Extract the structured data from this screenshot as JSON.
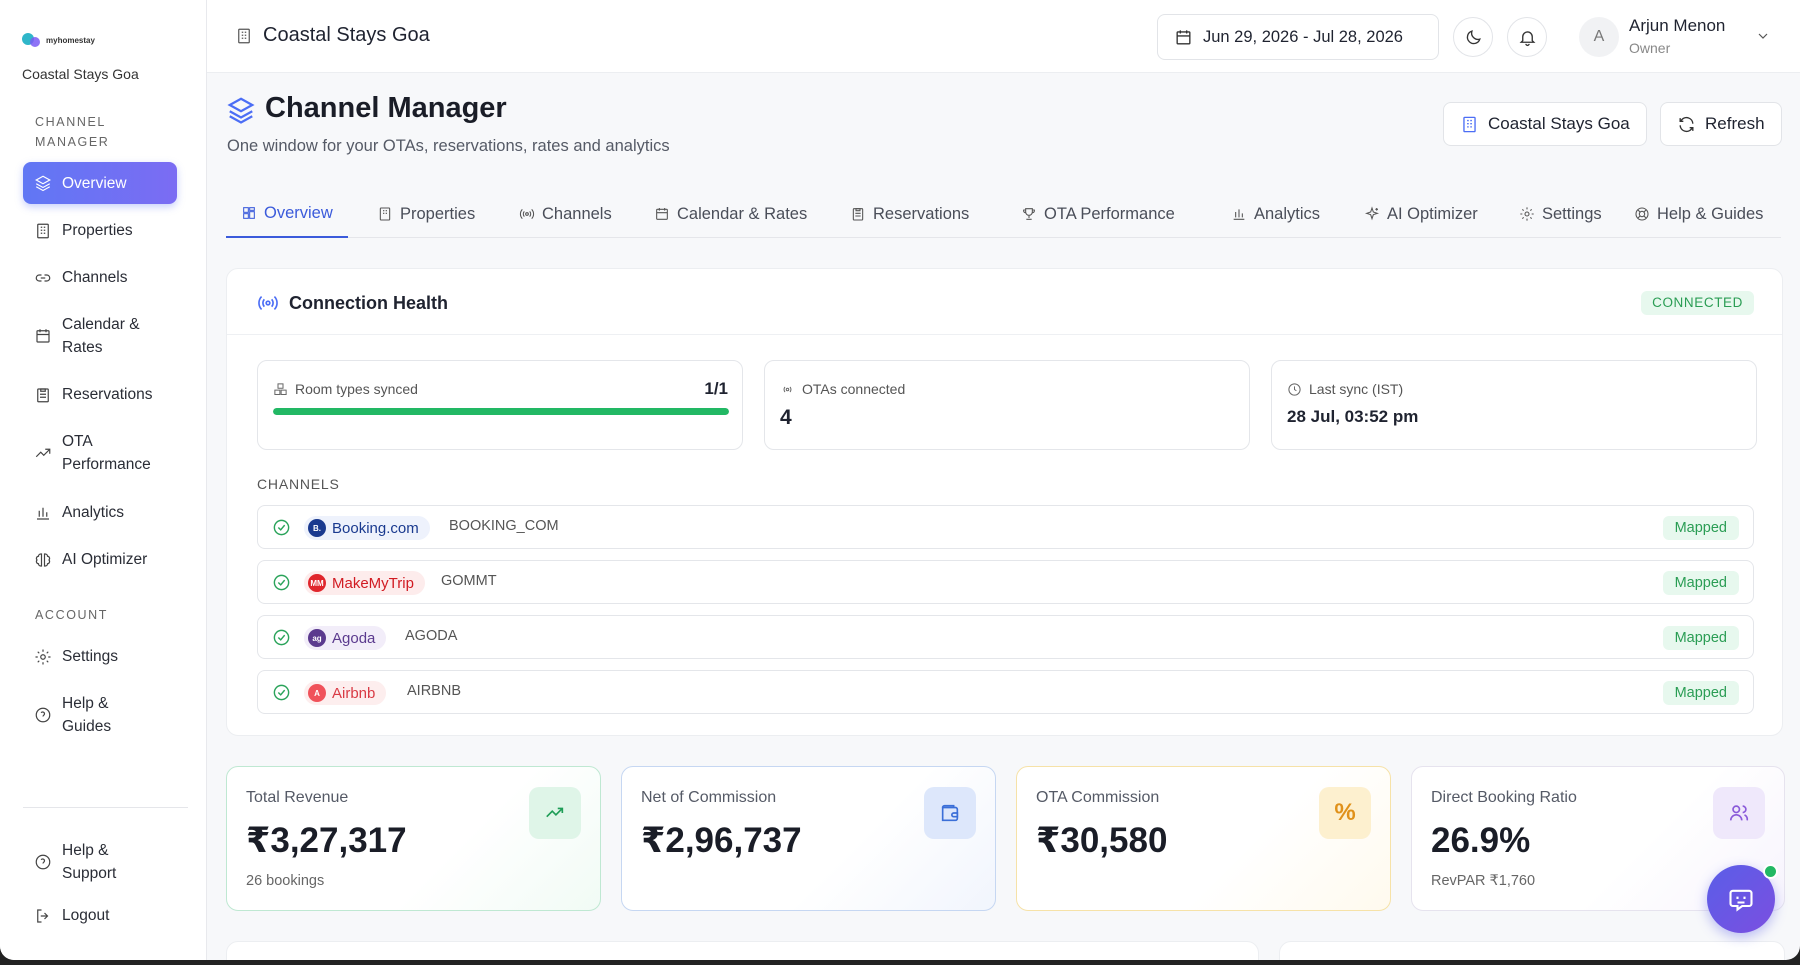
{
  "brand": {
    "logo_text": "myhomestay",
    "property": "Coastal Stays Goa"
  },
  "sidebar": {
    "section_channel": "CHANNEL\nMANAGER",
    "section_account": "ACCOUNT",
    "items": [
      {
        "label": "Overview",
        "icon": "layers-icon"
      },
      {
        "label": "Properties",
        "icon": "building-icon"
      },
      {
        "label": "Channels",
        "icon": "link-icon"
      },
      {
        "label": "Calendar &\nRates",
        "icon": "calendar-icon"
      },
      {
        "label": "Reservations",
        "icon": "clipboard-icon"
      },
      {
        "label": "OTA\nPerformance",
        "icon": "trending-icon"
      },
      {
        "label": "Analytics",
        "icon": "bar-chart-icon"
      },
      {
        "label": "AI Optimizer",
        "icon": "brain-icon"
      },
      {
        "label": "Settings",
        "icon": "gear-icon"
      },
      {
        "label": "Help &\nGuides",
        "icon": "help-icon"
      },
      {
        "label": "Help &\nSupport",
        "icon": "help-icon"
      },
      {
        "label": "Logout",
        "icon": "logout-icon"
      }
    ]
  },
  "topbar": {
    "title": "Coastal Stays Goa",
    "date_range": "Jun 29, 2026 - Jul 28, 2026",
    "user": {
      "initial": "A",
      "name": "Arjun Menon",
      "role": "Owner"
    }
  },
  "header": {
    "title": "Channel Manager",
    "subtitle": "One window for your OTAs, reservations, rates and analytics",
    "property_button": "Coastal Stays Goa",
    "refresh_button": "Refresh"
  },
  "tabs": [
    {
      "label": "Overview",
      "icon": "grid-icon"
    },
    {
      "label": "Properties",
      "icon": "building-icon"
    },
    {
      "label": "Channels",
      "icon": "broadcast-icon"
    },
    {
      "label": "Calendar & Rates",
      "icon": "calendar-icon"
    },
    {
      "label": "Reservations",
      "icon": "clipboard-icon"
    },
    {
      "label": "OTA Performance",
      "icon": "trophy-icon"
    },
    {
      "label": "Analytics",
      "icon": "bar-chart-icon"
    },
    {
      "label": "AI Optimizer",
      "icon": "sparkles-icon"
    },
    {
      "label": "Settings",
      "icon": "gear-icon"
    },
    {
      "label": "Help & Guides",
      "icon": "lifebuoy-icon"
    }
  ],
  "health": {
    "title": "Connection Health",
    "status": "CONNECTED",
    "room_types_label": "Room types synced",
    "room_types_value": "1/1",
    "room_types_progress": 1.0,
    "otas_label": "OTAs connected",
    "otas_value": "4",
    "last_sync_label": "Last sync (IST)",
    "last_sync_value": "28 Jul, 03:52 pm",
    "channels_heading": "CHANNELS",
    "channels": [
      {
        "name": "Booking.com",
        "code": "BOOKING_COM",
        "status": "Mapped",
        "logo": "B.",
        "color": "#1a3a8f",
        "bg": "#eef2fc",
        "text": "#1a3a8f"
      },
      {
        "name": "MakeMyTrip",
        "code": "GOMMT",
        "status": "Mapped",
        "logo": "MM",
        "color": "#e0262c",
        "bg": "#fdecec",
        "text": "#d11b22"
      },
      {
        "name": "Agoda",
        "code": "AGODA",
        "status": "Mapped",
        "logo": "ag",
        "color": "#5b3a8e",
        "bg": "#f2edf9",
        "text": "#5b3a8e"
      },
      {
        "name": "Airbnb",
        "code": "AIRBNB",
        "status": "Mapped",
        "logo": "A",
        "color": "#f0525a",
        "bg": "#fdeeee",
        "text": "#d93a44"
      }
    ]
  },
  "kpis": [
    {
      "label": "Total Revenue",
      "value": "₹3,27,317",
      "sub": "26 bookings",
      "icon": "trending-up-icon"
    },
    {
      "label": "Net of Commission",
      "value": "₹2,96,737",
      "sub": "",
      "icon": "wallet-icon"
    },
    {
      "label": "OTA Commission",
      "value": "₹30,580",
      "sub": "",
      "icon": "percent-icon",
      "glyph": "%"
    },
    {
      "label": "Direct Booking Ratio",
      "value": "26.9%",
      "sub": "RevPAR ₹1,760",
      "icon": "users-icon"
    }
  ]
}
